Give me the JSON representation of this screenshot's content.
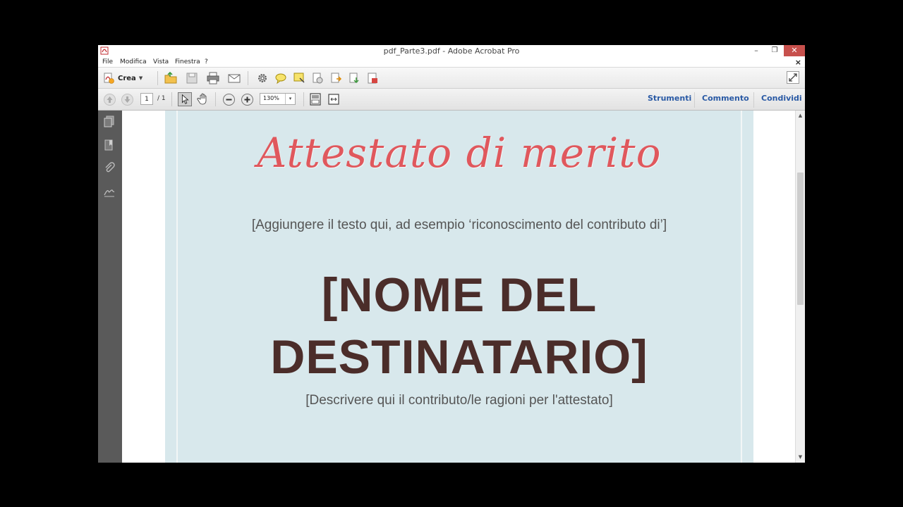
{
  "window": {
    "title": "pdf_Parte3.pdf - Adobe Acrobat Pro",
    "minimize_glyph": "–",
    "maximize_glyph": "❐",
    "close_glyph": "✕"
  },
  "menu": {
    "items": [
      "File",
      "Modifica",
      "Vista",
      "Finestra",
      "?"
    ],
    "close_doc_glyph": "×"
  },
  "toolbar": {
    "create_label": "Crea",
    "icons": [
      "open-folder-icon",
      "save-icon",
      "print-icon",
      "email-icon",
      "settings-icon",
      "comment-icon",
      "sticky-note-icon",
      "stamp-icon",
      "export-icon",
      "combine-icon",
      "pdf-form-icon"
    ]
  },
  "nav_toolbar": {
    "page_current": "1",
    "page_total": "/ 1",
    "zoom": "130%",
    "zoom_arrow": "▾",
    "pane_links": [
      "Strumenti",
      "Commento",
      "Condividi"
    ]
  },
  "document": {
    "title": "Attestato di merito",
    "intro": "[Aggiungere il testo qui, ad esempio ‘riconoscimento del contributo di’]",
    "name_line1": "[NOME DEL",
    "name_line2": "DESTINATARIO]",
    "description": "[Descrivere qui il contributo/le ragioni per l'attestato]"
  },
  "colors": {
    "title_red": "#e0585d",
    "name_brown": "#4b2d2a",
    "page_bg": "#d8e8ec",
    "link_blue": "#2a5aa5",
    "close_red": "#c7504c"
  },
  "scrollbar": {
    "up": "▲",
    "down": "▼"
  }
}
